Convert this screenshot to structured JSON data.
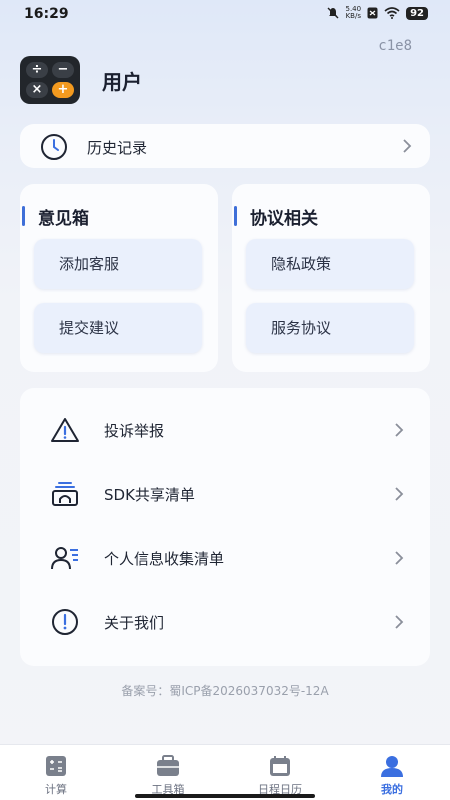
{
  "status_bar": {
    "time": "16:29",
    "net_speed_value": "5.40",
    "net_speed_unit": "KB/s",
    "battery": "92"
  },
  "header": {
    "code": "c1e8",
    "username": "用户",
    "logo_keys": [
      "÷",
      "−",
      "×",
      "+"
    ]
  },
  "history": {
    "label": "历史记录"
  },
  "feedback": {
    "title": "意见箱",
    "items": [
      {
        "label": "添加客服"
      },
      {
        "label": "提交建议"
      }
    ]
  },
  "agreements": {
    "title": "协议相关",
    "items": [
      {
        "label": "隐私政策"
      },
      {
        "label": "服务协议"
      }
    ]
  },
  "menu": [
    {
      "label": "投诉举报",
      "icon": "warning-icon"
    },
    {
      "label": "SDK共享清单",
      "icon": "sdk-share-icon"
    },
    {
      "label": "个人信息收集清单",
      "icon": "personal-info-icon"
    },
    {
      "label": "关于我们",
      "icon": "info-exclamation-icon"
    }
  ],
  "icp": "备案号：蜀ICP备2026037032号-12A",
  "tabs": [
    {
      "label": "计算",
      "icon": "calculator-icon"
    },
    {
      "label": "工具箱",
      "icon": "toolbox-icon"
    },
    {
      "label": "日程日历",
      "icon": "calendar-icon"
    },
    {
      "label": "我的",
      "icon": "profile-icon",
      "active": true
    }
  ],
  "colors": {
    "accent": "#3b6fe0",
    "logo_orange": "#f39a1f"
  }
}
